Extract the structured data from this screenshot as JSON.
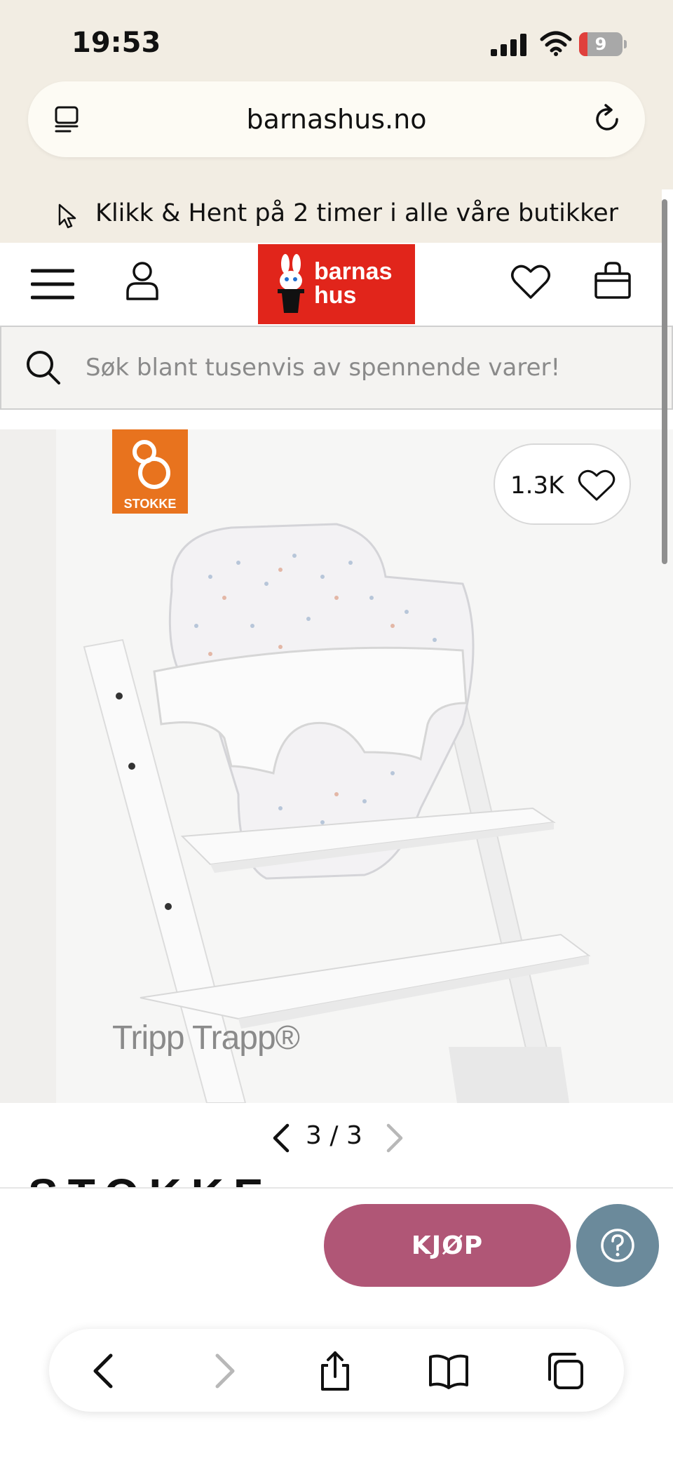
{
  "status_bar": {
    "time": "19:53",
    "battery_level": "9",
    "icons": [
      "signal-icon",
      "wifi-icon",
      "battery-icon"
    ]
  },
  "browser": {
    "url": "barnashus.no",
    "icons": [
      "reader-icon",
      "reload-icon"
    ]
  },
  "promo": {
    "text": "Klikk & Hent på 2 timer i alle våre butikker",
    "icon": "cursor-icon"
  },
  "header": {
    "logo_line1": "barnas",
    "logo_line2": "hus",
    "icons": [
      "menu-icon",
      "user-icon",
      "heart-icon",
      "bag-icon"
    ]
  },
  "search": {
    "placeholder": "Søk blant tusenvis av spennende varer!"
  },
  "gallery": {
    "brand_badge": "STOKKE",
    "like_count": "1.3K",
    "product_watermark": "Tripp Trapp®",
    "current_page": "3",
    "separator": "/",
    "total_pages": "3",
    "brand_name": "STOKKE"
  },
  "actions": {
    "buy_label": "KJØP",
    "help_icon": "question-icon"
  },
  "colors": {
    "brand_red": "#e1251b",
    "buy_button": "#b05676",
    "help_button": "#6b8a9b",
    "stokke_orange": "#e8731e",
    "top_bar_beige": "#f2ede3"
  },
  "toolbar": {
    "icons": [
      "back-icon",
      "forward-icon",
      "share-icon",
      "bookmarks-icon",
      "tabs-icon"
    ]
  }
}
